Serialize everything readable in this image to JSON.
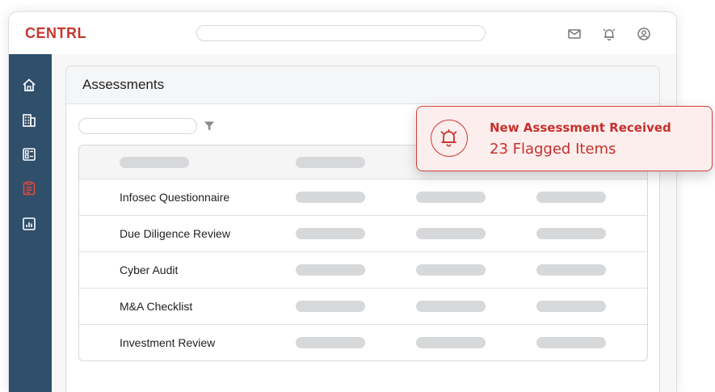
{
  "app": {
    "logo": "CENTRL",
    "search": {
      "value": "",
      "placeholder": ""
    },
    "top_icons": [
      "mail-icon",
      "bell-icon",
      "user-icon"
    ]
  },
  "sidebar": {
    "items": [
      {
        "icon": "home-icon",
        "active": false
      },
      {
        "icon": "building-icon",
        "active": false
      },
      {
        "icon": "dashboard-icon",
        "active": false
      },
      {
        "icon": "clipboard-icon",
        "active": true
      },
      {
        "icon": "report-chart-icon",
        "active": false
      }
    ],
    "colors": {
      "background": "#2f4f6b",
      "icon": "#ffffff",
      "active": "#e0493e"
    }
  },
  "main": {
    "title": "Assessments",
    "filter": {
      "value": "",
      "placeholder": ""
    },
    "table": {
      "rows": [
        {
          "name": "Infosec Questionnaire"
        },
        {
          "name": "Due Diligence Review"
        },
        {
          "name": "Cyber Audit"
        },
        {
          "name": "M&A Checklist"
        },
        {
          "name": "Investment Review"
        }
      ]
    }
  },
  "notification": {
    "title": "New Assessment Received",
    "subtitle": "23 Flagged Items",
    "icon": "alarm-bell-icon",
    "color": "#c7302b"
  },
  "colors": {
    "brand": "#c5362f",
    "placeholder": "#d7d8da"
  }
}
